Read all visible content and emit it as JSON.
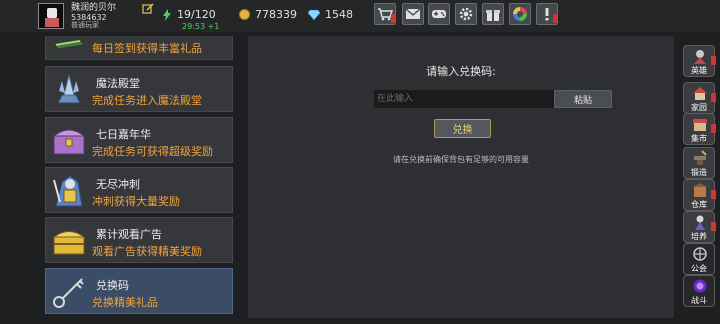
{
  "player": {
    "name": "魏润的贝尔",
    "id": "5384632",
    "rank": "普通玩家",
    "energy": "19/120",
    "timer": "29:53 +1",
    "gold": "778339",
    "gems": "1548"
  },
  "toolbar": {
    "buttons": [
      {
        "name": "shop-cart-icon",
        "badge": true
      },
      {
        "name": "mail-icon",
        "badge": false
      },
      {
        "name": "gamepad-icon",
        "badge": false
      },
      {
        "name": "settings-gear-icon",
        "badge": false
      },
      {
        "name": "gift-icon",
        "badge": false
      },
      {
        "name": "color-wheel-icon",
        "badge": false
      },
      {
        "name": "exclamation-icon",
        "badge": true
      }
    ]
  },
  "activities": [
    {
      "title": "",
      "desc": "每日签到获得丰富礼品",
      "icon": "book-icon"
    },
    {
      "title": "魔法殿堂",
      "desc": "完成任务进入魔法殿堂",
      "icon": "crystal-altar-icon"
    },
    {
      "title": "七日嘉年华",
      "desc": "完成任务可获得超级奖励",
      "icon": "treasure-chest-icon"
    },
    {
      "title": "无尽冲刺",
      "desc": "冲刺获得大量奖励",
      "icon": "knight-icon"
    },
    {
      "title": "累计观看广告",
      "desc": "观看广告获得精美奖励",
      "icon": "gold-chest-icon"
    },
    {
      "title": "兑换码",
      "desc": "兑换精美礼品",
      "icon": "key-icon"
    }
  ],
  "redeem": {
    "prompt": "请输入兑换码:",
    "placeholder": "在此输入",
    "paste_label": "粘贴",
    "redeem_label": "兑换",
    "note": "请在兑换前确保背包有足够的可用容量"
  },
  "sidebar": [
    {
      "label": "英雄",
      "icon": "hero-icon",
      "badge": true
    },
    {
      "label": "家园",
      "icon": "home-icon",
      "badge": true
    },
    {
      "label": "集市",
      "icon": "market-icon",
      "badge": true
    },
    {
      "label": "锻造",
      "icon": "anvil-icon",
      "badge": false
    },
    {
      "label": "仓库",
      "icon": "warehouse-icon",
      "badge": true
    },
    {
      "label": "培养",
      "icon": "training-icon",
      "badge": true
    },
    {
      "label": "公会",
      "icon": "guild-icon",
      "badge": false
    },
    {
      "label": "战斗",
      "icon": "portal-icon",
      "badge": false
    }
  ],
  "colors": {
    "accent_orange": "#f2a43c",
    "timer_green": "#4fd062",
    "active_item": "#3b4d66",
    "badge_red": "#d23434"
  }
}
